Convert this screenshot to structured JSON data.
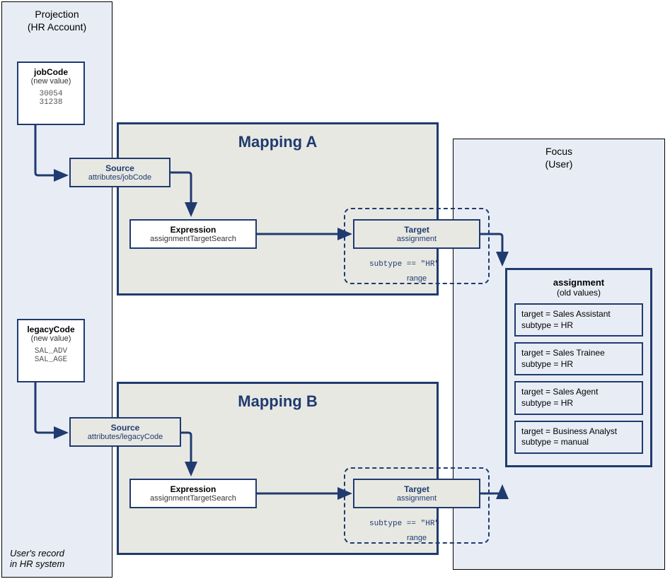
{
  "projection": {
    "title_line1": "Projection",
    "title_line2": "(HR Account)",
    "jobCode": {
      "name": "jobCode",
      "sub": "(new value)",
      "values": [
        "30054",
        "31238"
      ]
    },
    "legacyCode": {
      "name": "legacyCode",
      "sub": "(new value)",
      "values": [
        "SAL_ADV",
        "SAL_AGE"
      ]
    },
    "footnote_line1": "User's record",
    "footnote_line2": "in HR system"
  },
  "mappingA": {
    "title": "Mapping A",
    "source": {
      "label": "Source",
      "path": "attributes/jobCode"
    },
    "expression": {
      "label": "Expression",
      "value": "assignmentTargetSearch"
    },
    "target": {
      "label": "Target",
      "value": "assignment"
    },
    "range": {
      "condition": "subtype == \"HR\"",
      "label": "range"
    }
  },
  "mappingB": {
    "title": "Mapping B",
    "source": {
      "label": "Source",
      "path": "attributes/legacyCode"
    },
    "expression": {
      "label": "Expression",
      "value": "assignmentTargetSearch"
    },
    "target": {
      "label": "Target",
      "value": "assignment"
    },
    "range": {
      "condition": "subtype == \"HR\"",
      "label": "range"
    }
  },
  "focus": {
    "title_line1": "Focus",
    "title_line2": "(User)",
    "assignment": {
      "label": "assignment",
      "sub": "(old values)",
      "items": [
        {
          "target": "Sales Assistant",
          "subtype": "HR"
        },
        {
          "target": "Sales Trainee",
          "subtype": "HR"
        },
        {
          "target": "Sales Agent",
          "subtype": "HR"
        },
        {
          "target": "Business Analyst",
          "subtype": "manual"
        }
      ]
    }
  }
}
